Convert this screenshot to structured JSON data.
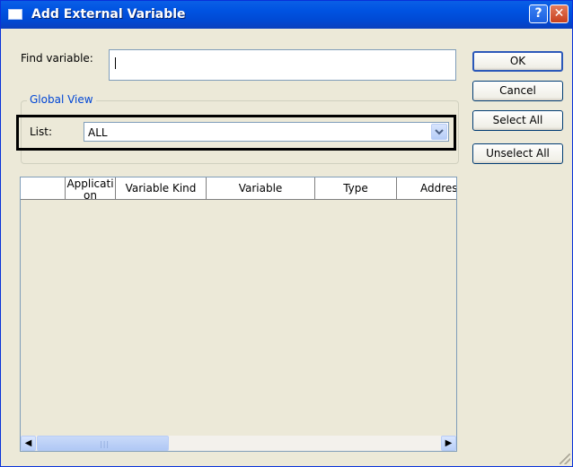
{
  "window": {
    "title": "Add External Variable",
    "help_glyph": "?",
    "close_glyph": "✕"
  },
  "find": {
    "label": "Find variable:",
    "value": ""
  },
  "global_view": {
    "title": "Global View",
    "list_label": "List:",
    "list_value": "ALL"
  },
  "buttons": {
    "ok": "OK",
    "cancel": "Cancel",
    "select_all": "Select All",
    "unselect_all": "Unselect All"
  },
  "table": {
    "columns": [
      "",
      "Application",
      "Variable Kind",
      "Variable",
      "Type",
      "Address"
    ],
    "rows": []
  },
  "scrollbar": {
    "left_glyph": "◀",
    "right_glyph": "▶",
    "grip": "|||"
  },
  "colors": {
    "titlebar": "#0053e1",
    "dialog_bg": "#ece9d8",
    "group_title": "#0046d5"
  }
}
